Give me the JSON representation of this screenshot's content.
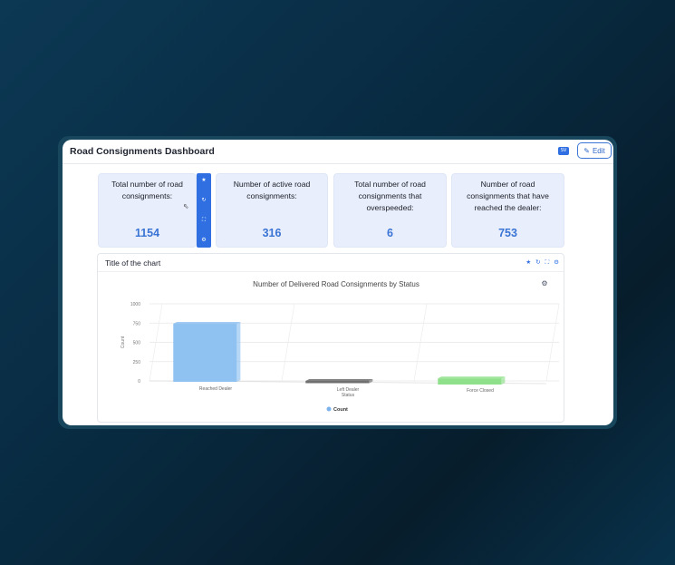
{
  "dashboard": {
    "title": "Road Consignments Dashboard",
    "export_label": "SV",
    "edit_label": "Edit",
    "edit_icon": "pencil-square-icon"
  },
  "kpis": [
    {
      "label": "Total number of road consignments:",
      "value": "1154"
    },
    {
      "label": "Number of active road consignments:",
      "value": "316"
    },
    {
      "label": "Total number of road consignments that overspeeded:",
      "value": "6"
    },
    {
      "label": "Number of road consignments that have reached the dealer:",
      "value": "753"
    }
  ],
  "kpi_toolbar": {
    "icons": [
      "star-icon",
      "refresh-icon",
      "expand-icon",
      "settings-icon"
    ],
    "glyphs": [
      "★",
      "↻",
      "⛶",
      "⚙"
    ]
  },
  "chart_panel": {
    "title": "Title of the chart",
    "icons": [
      "star-icon",
      "refresh-icon",
      "expand-icon",
      "settings-icon"
    ],
    "glyphs": [
      "★",
      "↻",
      "⛶",
      "⚙"
    ]
  },
  "chart_data": {
    "type": "bar",
    "title": "Number of Delivered Road Consignments by Status",
    "xlabel": "Status",
    "ylabel": "Count",
    "categories": [
      "Reached Dealer",
      "Left Dealer",
      "Force Closed"
    ],
    "series": [
      {
        "name": "Count",
        "values": [
          753,
          30,
          80
        ]
      }
    ],
    "bar_colors": [
      "#8fc1f1",
      "#6f6f6f",
      "#8fe08a"
    ],
    "yticks": [
      0,
      250,
      500,
      750,
      1000
    ],
    "ylim": [
      0,
      1000
    ],
    "grid": true,
    "legend_position": "bottom",
    "legend_color": "#7cb3ec"
  }
}
